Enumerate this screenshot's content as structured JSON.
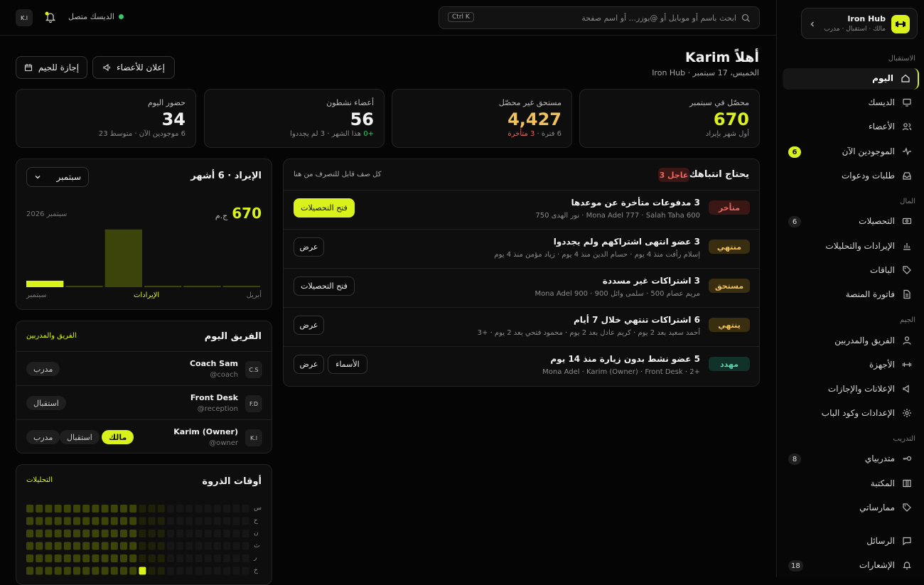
{
  "topbar": {
    "search_placeholder": "ابحث باسم أو موبايل أو @يوزر... أو اسم صفحة",
    "shortcut": "Ctrl K",
    "desk_status": "الديسك متصل",
    "user_initials": "K.ا"
  },
  "sidebar": {
    "gym_name": "Iron Hub",
    "gym_roles": "مالك · استقبال · مدرب",
    "sections": {
      "reception": "الاستقبال",
      "money": "المال",
      "gym": "الجيم",
      "training": "التدريب"
    },
    "items": [
      {
        "label": "اليوم",
        "icon": "home-icon"
      },
      {
        "label": "الديسك",
        "icon": "monitor-icon"
      },
      {
        "label": "الأعضاء",
        "icon": "users-icon"
      },
      {
        "label": "الموجودين الآن",
        "icon": "pulse-icon",
        "count": "6"
      },
      {
        "label": "طلبات ودعوات",
        "icon": "inbox-icon"
      },
      {
        "label": "التحصيلات",
        "icon": "cash-icon",
        "count": "6"
      },
      {
        "label": "الإيرادات والتحليلات",
        "icon": "bar-chart-icon"
      },
      {
        "label": "الباقات",
        "icon": "tag-icon"
      },
      {
        "label": "فاتورة المنصة",
        "icon": "file-icon"
      },
      {
        "label": "الفريق والمدربين",
        "icon": "user-icon"
      },
      {
        "label": "الأجهزة",
        "icon": "dumbbell-icon"
      },
      {
        "label": "الإعلانات والإجازات",
        "icon": "megaphone-icon"
      },
      {
        "label": "الإعدادات وكود الباب",
        "icon": "settings-icon"
      },
      {
        "label": "متدربياي",
        "icon": "key-icon",
        "count": "8"
      },
      {
        "label": "المكتبة",
        "icon": "book-icon"
      },
      {
        "label": "ممارساتي",
        "icon": "tag-icon"
      },
      {
        "label": "الرسائل",
        "icon": "message-icon"
      },
      {
        "label": "الإشعارات",
        "icon": "bell-icon",
        "count": "18"
      }
    ]
  },
  "header": {
    "greeting": "أهلاً Karim",
    "subtitle": "الخميس، 17 سبتمبر · Iron Hub",
    "announce_button": "إعلان للأعضاء",
    "holiday_button": "إجازة للجيم"
  },
  "stats": [
    {
      "label": "محصّل في سبتمبر",
      "value": "670",
      "sub": "أول شهر بإيراد",
      "color": "#d9f21b"
    },
    {
      "label": "مستحق غير محصّل",
      "value": "4,427",
      "sub_a": "6 فترة · ",
      "sub_b": "3 متأخرة",
      "color": "#f2c25a"
    },
    {
      "label": "أعضاء نشطون",
      "value": "56",
      "sub_a": "+0",
      "sub_b": " هذا الشهر · 3 لم يجددوا",
      "color": "#ffffff"
    },
    {
      "label": "حضور اليوم",
      "value": "34",
      "sub": "6 موجودين الآن · متوسط 23",
      "color": "#ffffff"
    }
  ],
  "attention": {
    "title": "يحتاج انتباهك",
    "urgent": "3 عاجل",
    "hint": "كل صف قابل للتصرف من هنا",
    "rows": [
      {
        "badge": "متأخر",
        "badge_color": "#e8695f",
        "badge_bg": "#3a1614",
        "title": "3 مدفوعات متأخرة عن موعدها",
        "sub": "Mona Adel 777 · Salah Taha 600 · نور الهدى 750",
        "actions": [
          "فتح التحصيلات"
        ],
        "primary": true
      },
      {
        "badge": "منتهي",
        "badge_color": "#f2c25a",
        "badge_bg": "#3a2e10",
        "title": "3 عضو انتهى اشتراكهم ولم يجددوا",
        "sub": "إسلام رأفت منذ 4 يوم · حسام الدين منذ 4 يوم · زياد مؤمن منذ 4 يوم",
        "actions": [
          "عرض"
        ],
        "primary": false
      },
      {
        "badge": "مستحق",
        "badge_color": "#f2c25a",
        "badge_bg": "#3a2e10",
        "title": "3 اشتراكات غير مسددة",
        "sub": "مريم عصام 500 · سلمى وائل 900 · Mona Adel 900",
        "actions": [
          "فتح التحصيلات"
        ],
        "primary": false
      },
      {
        "badge": "ينتهي",
        "badge_color": "#f2c25a",
        "badge_bg": "#3a2e10",
        "title": "6 اشتراكات تنتهي خلال 7 أيام",
        "sub": "أحمد سعيد بعد 2 يوم · كريم عادل بعد 2 يوم · محمود فتحي بعد 2 يوم · +3",
        "actions": [
          "عرض"
        ],
        "primary": false
      },
      {
        "badge": "مهدد",
        "badge_color": "#5fd6a8",
        "badge_bg": "#10322a",
        "title": "5 عضو نشط بدون زيارة منذ 14 يوم",
        "sub": "+2 · Mona Adel · Karim (Owner) · Front Desk",
        "actions": [
          "الأسماء",
          "عرض"
        ],
        "primary": false
      }
    ]
  },
  "revenue": {
    "title": "الإيراد · 6 أشهر",
    "month_select": "سبتمبر",
    "amount": "670",
    "currency": "ج.م",
    "period": "سبتمبر 2026",
    "axis_left": "سبتمبر",
    "axis_mid": "الإيرادات",
    "axis_right": "أبريل"
  },
  "chart_data": {
    "type": "bar",
    "categories": [
      "سبتمبر",
      "",
      "",
      "",
      "",
      "أبريل"
    ],
    "values": [
      670,
      20,
      6000,
      20,
      20,
      20
    ],
    "title": "الإيراد · 6 أشهر",
    "xlabel": "الإيرادات",
    "ylabel": "",
    "ylim": [
      0,
      6500
    ],
    "colors": [
      "#d9f21b",
      "#3d4409",
      "#3d4409",
      "#3d4409",
      "#3d4409",
      "#3d4409"
    ]
  },
  "team": {
    "title": "الفريق اليوم",
    "link": "الفريق والمدربين",
    "members": [
      {
        "initials": "C.S",
        "name": "Coach Sam",
        "handle": "@coach",
        "roles": [
          "مدرب"
        ]
      },
      {
        "initials": "F.D",
        "name": "Front Desk",
        "handle": "@reception",
        "roles": [
          "استقبال"
        ]
      },
      {
        "initials": "K.ا",
        "name": "Karim (Owner)",
        "handle": "@owner",
        "roles": [
          "مالك",
          "استقبال",
          "مدرب"
        ]
      }
    ]
  },
  "peak": {
    "title": "أوقات الذروة",
    "link": "التحليلات",
    "day_labels": [
      "س",
      "ح",
      "ن",
      "ث",
      "ر",
      "خ"
    ]
  }
}
